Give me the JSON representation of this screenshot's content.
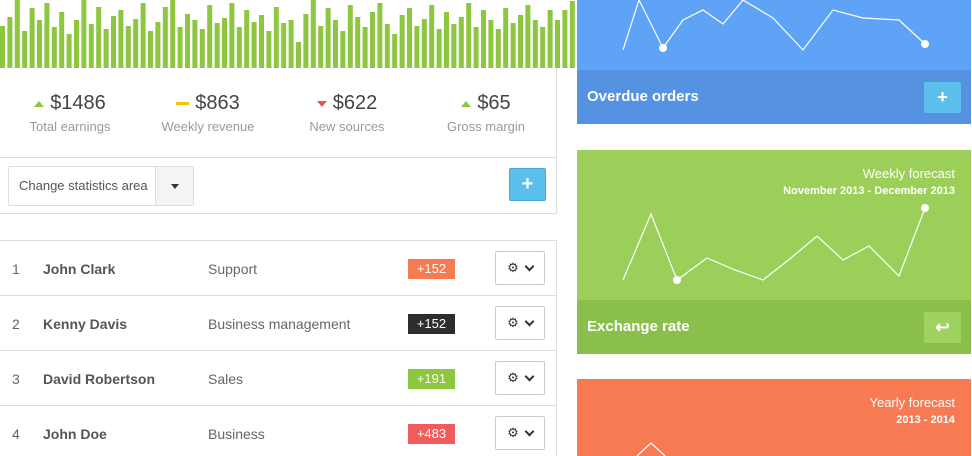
{
  "bars": {
    "color": "#8dc63f",
    "values": [
      0.62,
      0.75,
      1.0,
      0.55,
      0.88,
      0.7,
      0.95,
      0.6,
      0.82,
      0.5,
      0.7,
      1.0,
      0.65,
      0.9,
      0.58,
      0.77,
      0.85,
      0.62,
      0.72,
      0.95,
      0.55,
      0.68,
      0.9,
      1.0,
      0.6,
      0.8,
      0.7,
      0.58,
      0.92,
      0.66,
      0.74,
      0.95,
      0.6,
      0.85,
      0.68,
      0.78,
      0.55,
      0.9,
      0.66,
      0.7,
      0.38,
      0.8,
      1.0,
      0.62,
      0.88,
      0.7,
      0.55,
      0.92,
      0.75,
      0.6,
      0.82,
      0.95,
      0.65,
      0.5,
      0.78,
      0.88,
      0.62,
      0.72,
      0.92,
      0.58,
      0.82,
      0.65,
      0.75,
      0.95,
      0.6,
      0.85,
      0.7,
      0.58,
      0.88,
      0.66,
      0.78,
      0.92,
      0.7,
      0.6,
      0.85,
      0.7,
      0.85,
      0.98
    ]
  },
  "stats": [
    {
      "value": "$1486",
      "label": "Total earnings",
      "trend": "up"
    },
    {
      "value": "$863",
      "label": "Weekly revenue",
      "trend": "flat"
    },
    {
      "value": "$622",
      "label": "New sources",
      "trend": "down"
    },
    {
      "value": "$65",
      "label": "Gross margin",
      "trend": "up"
    }
  ],
  "controls": {
    "select_label": "Change statistics area",
    "add_icon": "+"
  },
  "table": [
    {
      "num": "1",
      "name": "John Clark",
      "dept": "Support",
      "badge": "+152",
      "badge_color": "#f87a53"
    },
    {
      "num": "2",
      "name": "Kenny Davis",
      "dept": "Business management",
      "badge": "+152",
      "badge_color": "#2d2d2d"
    },
    {
      "num": "3",
      "name": "David Robertson",
      "dept": "Sales",
      "badge": "+191",
      "badge_color": "#8dc63f"
    },
    {
      "num": "4",
      "name": "John Doe",
      "dept": "Business",
      "badge": "+483",
      "badge_color": "#f25b5b"
    }
  ],
  "cards": {
    "blue": {
      "title": "Overdue orders",
      "button_icon": "plus-icon",
      "button_glyph": "+",
      "color": "#5ea3f5"
    },
    "green": {
      "title": "Exchange rate",
      "forecast": "Weekly forecast",
      "range": "November 2013 - December 2013",
      "button_icon": "reply-icon",
      "button_glyph": "↩",
      "color": "#9ccf5a"
    },
    "red": {
      "forecast": "Yearly forecast",
      "range": "2013 - 2014",
      "color": "#f87a53"
    }
  }
}
